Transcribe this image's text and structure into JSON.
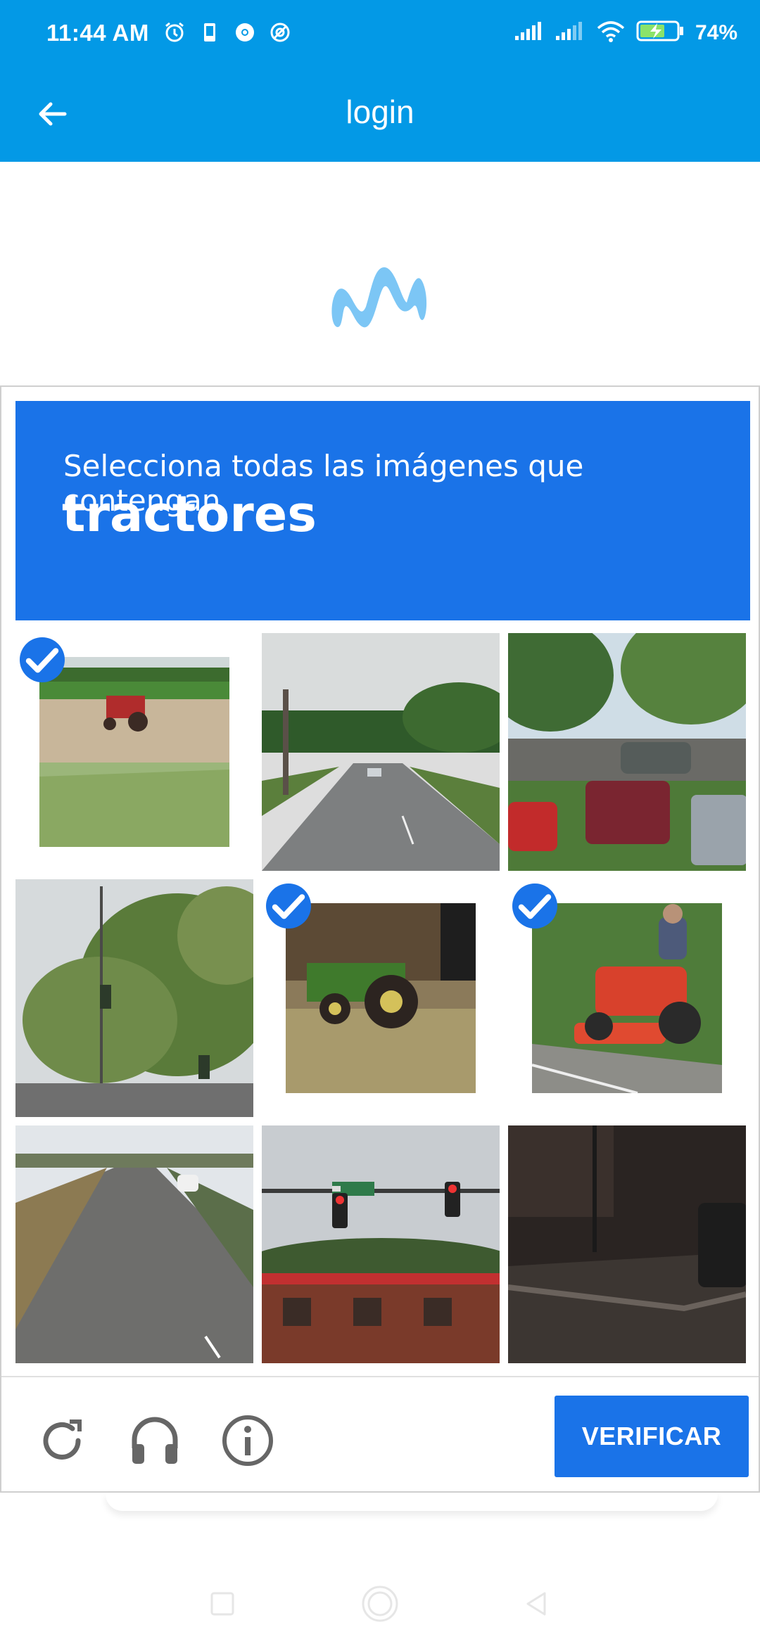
{
  "status_bar": {
    "time": "11:44 AM",
    "battery_percent": "74%",
    "icons_left": [
      "alarm-icon",
      "phone-icon",
      "chrome-icon",
      "sync-icon"
    ],
    "icons_right": [
      "signal-icon",
      "signal-icon",
      "wifi-icon",
      "battery-charging-icon"
    ]
  },
  "app_bar": {
    "title": "login",
    "back_icon": "arrow-left-icon"
  },
  "logo": {
    "name": "movistar-logo",
    "color": "#7cc6f5"
  },
  "captcha": {
    "instruction": "Selecciona todas las imágenes que contengan",
    "target": "tractores",
    "tiles": [
      {
        "name": "tractor-field",
        "selected": true
      },
      {
        "name": "road-street",
        "selected": false
      },
      {
        "name": "parking-cars",
        "selected": false
      },
      {
        "name": "trees-traffic-light",
        "selected": false
      },
      {
        "name": "green-tractor",
        "selected": true
      },
      {
        "name": "red-mower-tractor",
        "selected": true
      },
      {
        "name": "highway",
        "selected": false
      },
      {
        "name": "traffic-light-store",
        "selected": false
      },
      {
        "name": "dark-street",
        "selected": false
      }
    ],
    "footer": {
      "reload_icon": "reload-icon",
      "audio_icon": "headphones-icon",
      "info_icon": "info-icon",
      "verify_label": "VERIFICAR"
    }
  },
  "colors": {
    "app_bar": "#0399e6",
    "captcha_blue": "#1a73e8"
  },
  "nav_bar": {
    "icons": [
      "recent-apps-icon",
      "home-icon",
      "back-icon"
    ]
  }
}
